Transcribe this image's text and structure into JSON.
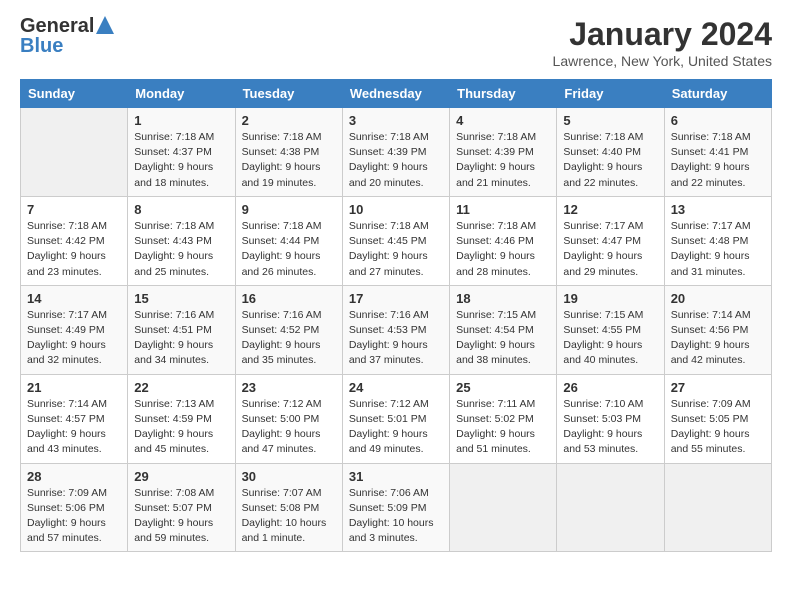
{
  "header": {
    "logo_general": "General",
    "logo_blue": "Blue",
    "month_title": "January 2024",
    "location": "Lawrence, New York, United States"
  },
  "days_of_week": [
    "Sunday",
    "Monday",
    "Tuesday",
    "Wednesday",
    "Thursday",
    "Friday",
    "Saturday"
  ],
  "weeks": [
    [
      {
        "num": "",
        "sunrise": "",
        "sunset": "",
        "daylight": "",
        "empty": true
      },
      {
        "num": "1",
        "sunrise": "Sunrise: 7:18 AM",
        "sunset": "Sunset: 4:37 PM",
        "daylight": "Daylight: 9 hours and 18 minutes."
      },
      {
        "num": "2",
        "sunrise": "Sunrise: 7:18 AM",
        "sunset": "Sunset: 4:38 PM",
        "daylight": "Daylight: 9 hours and 19 minutes."
      },
      {
        "num": "3",
        "sunrise": "Sunrise: 7:18 AM",
        "sunset": "Sunset: 4:39 PM",
        "daylight": "Daylight: 9 hours and 20 minutes."
      },
      {
        "num": "4",
        "sunrise": "Sunrise: 7:18 AM",
        "sunset": "Sunset: 4:39 PM",
        "daylight": "Daylight: 9 hours and 21 minutes."
      },
      {
        "num": "5",
        "sunrise": "Sunrise: 7:18 AM",
        "sunset": "Sunset: 4:40 PM",
        "daylight": "Daylight: 9 hours and 22 minutes."
      },
      {
        "num": "6",
        "sunrise": "Sunrise: 7:18 AM",
        "sunset": "Sunset: 4:41 PM",
        "daylight": "Daylight: 9 hours and 22 minutes."
      }
    ],
    [
      {
        "num": "7",
        "sunrise": "Sunrise: 7:18 AM",
        "sunset": "Sunset: 4:42 PM",
        "daylight": "Daylight: 9 hours and 23 minutes."
      },
      {
        "num": "8",
        "sunrise": "Sunrise: 7:18 AM",
        "sunset": "Sunset: 4:43 PM",
        "daylight": "Daylight: 9 hours and 25 minutes."
      },
      {
        "num": "9",
        "sunrise": "Sunrise: 7:18 AM",
        "sunset": "Sunset: 4:44 PM",
        "daylight": "Daylight: 9 hours and 26 minutes."
      },
      {
        "num": "10",
        "sunrise": "Sunrise: 7:18 AM",
        "sunset": "Sunset: 4:45 PM",
        "daylight": "Daylight: 9 hours and 27 minutes."
      },
      {
        "num": "11",
        "sunrise": "Sunrise: 7:18 AM",
        "sunset": "Sunset: 4:46 PM",
        "daylight": "Daylight: 9 hours and 28 minutes."
      },
      {
        "num": "12",
        "sunrise": "Sunrise: 7:17 AM",
        "sunset": "Sunset: 4:47 PM",
        "daylight": "Daylight: 9 hours and 29 minutes."
      },
      {
        "num": "13",
        "sunrise": "Sunrise: 7:17 AM",
        "sunset": "Sunset: 4:48 PM",
        "daylight": "Daylight: 9 hours and 31 minutes."
      }
    ],
    [
      {
        "num": "14",
        "sunrise": "Sunrise: 7:17 AM",
        "sunset": "Sunset: 4:49 PM",
        "daylight": "Daylight: 9 hours and 32 minutes."
      },
      {
        "num": "15",
        "sunrise": "Sunrise: 7:16 AM",
        "sunset": "Sunset: 4:51 PM",
        "daylight": "Daylight: 9 hours and 34 minutes."
      },
      {
        "num": "16",
        "sunrise": "Sunrise: 7:16 AM",
        "sunset": "Sunset: 4:52 PM",
        "daylight": "Daylight: 9 hours and 35 minutes."
      },
      {
        "num": "17",
        "sunrise": "Sunrise: 7:16 AM",
        "sunset": "Sunset: 4:53 PM",
        "daylight": "Daylight: 9 hours and 37 minutes."
      },
      {
        "num": "18",
        "sunrise": "Sunrise: 7:15 AM",
        "sunset": "Sunset: 4:54 PM",
        "daylight": "Daylight: 9 hours and 38 minutes."
      },
      {
        "num": "19",
        "sunrise": "Sunrise: 7:15 AM",
        "sunset": "Sunset: 4:55 PM",
        "daylight": "Daylight: 9 hours and 40 minutes."
      },
      {
        "num": "20",
        "sunrise": "Sunrise: 7:14 AM",
        "sunset": "Sunset: 4:56 PM",
        "daylight": "Daylight: 9 hours and 42 minutes."
      }
    ],
    [
      {
        "num": "21",
        "sunrise": "Sunrise: 7:14 AM",
        "sunset": "Sunset: 4:57 PM",
        "daylight": "Daylight: 9 hours and 43 minutes."
      },
      {
        "num": "22",
        "sunrise": "Sunrise: 7:13 AM",
        "sunset": "Sunset: 4:59 PM",
        "daylight": "Daylight: 9 hours and 45 minutes."
      },
      {
        "num": "23",
        "sunrise": "Sunrise: 7:12 AM",
        "sunset": "Sunset: 5:00 PM",
        "daylight": "Daylight: 9 hours and 47 minutes."
      },
      {
        "num": "24",
        "sunrise": "Sunrise: 7:12 AM",
        "sunset": "Sunset: 5:01 PM",
        "daylight": "Daylight: 9 hours and 49 minutes."
      },
      {
        "num": "25",
        "sunrise": "Sunrise: 7:11 AM",
        "sunset": "Sunset: 5:02 PM",
        "daylight": "Daylight: 9 hours and 51 minutes."
      },
      {
        "num": "26",
        "sunrise": "Sunrise: 7:10 AM",
        "sunset": "Sunset: 5:03 PM",
        "daylight": "Daylight: 9 hours and 53 minutes."
      },
      {
        "num": "27",
        "sunrise": "Sunrise: 7:09 AM",
        "sunset": "Sunset: 5:05 PM",
        "daylight": "Daylight: 9 hours and 55 minutes."
      }
    ],
    [
      {
        "num": "28",
        "sunrise": "Sunrise: 7:09 AM",
        "sunset": "Sunset: 5:06 PM",
        "daylight": "Daylight: 9 hours and 57 minutes."
      },
      {
        "num": "29",
        "sunrise": "Sunrise: 7:08 AM",
        "sunset": "Sunset: 5:07 PM",
        "daylight": "Daylight: 9 hours and 59 minutes."
      },
      {
        "num": "30",
        "sunrise": "Sunrise: 7:07 AM",
        "sunset": "Sunset: 5:08 PM",
        "daylight": "Daylight: 10 hours and 1 minute."
      },
      {
        "num": "31",
        "sunrise": "Sunrise: 7:06 AM",
        "sunset": "Sunset: 5:09 PM",
        "daylight": "Daylight: 10 hours and 3 minutes."
      },
      {
        "num": "",
        "sunrise": "",
        "sunset": "",
        "daylight": "",
        "empty": true
      },
      {
        "num": "",
        "sunrise": "",
        "sunset": "",
        "daylight": "",
        "empty": true
      },
      {
        "num": "",
        "sunrise": "",
        "sunset": "",
        "daylight": "",
        "empty": true
      }
    ]
  ]
}
